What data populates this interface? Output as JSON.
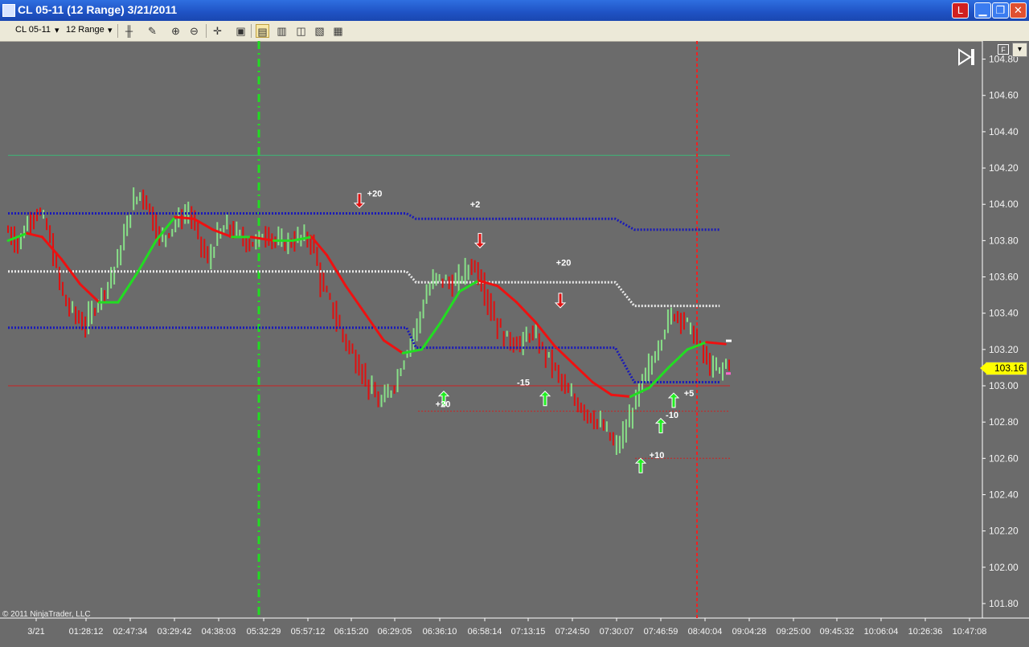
{
  "window": {
    "title": "CL 05-11 (12 Range)  3/21/2011",
    "close_glyph": "✕",
    "min_glyph": "▁",
    "max_glyph": "❐",
    "alert_glyph": "L"
  },
  "toolbar": {
    "instrument": "CL 05-11",
    "interval": "12 Range",
    "dropdown_glyph": "▾"
  },
  "copyright": "© 2011 NinjaTrader, LLC",
  "f_label": "F",
  "current_price_label": "103.16",
  "chart_data": {
    "type": "line",
    "title": "",
    "xlabel": "",
    "ylabel": "",
    "ylim": [
      101.72,
      104.9
    ],
    "yticks": [
      101.8,
      102.0,
      102.2,
      102.4,
      102.6,
      102.8,
      103.0,
      103.2,
      103.4,
      103.6,
      103.8,
      104.0,
      104.2,
      104.4,
      104.6,
      104.8
    ],
    "xtick_labels": [
      "3/21",
      "01:28:12",
      "02:47:34",
      "03:29:42",
      "04:38:03",
      "05:32:29",
      "05:57:12",
      "06:15:20",
      "06:29:05",
      "06:36:10",
      "06:58:14",
      "07:13:15",
      "07:24:50",
      "07:30:07",
      "07:46:59",
      "08:40:04",
      "09:04:28",
      "09:25:00",
      "09:45:32",
      "10:06:04",
      "10:26:36",
      "10:47:08"
    ],
    "bars_count": 225,
    "current_price": 103.16,
    "series": [
      {
        "name": "",
        "style": "close-line",
        "points": [
          [
            0,
            103.85
          ],
          [
            5,
            103.78
          ],
          [
            10,
            103.9
          ],
          [
            15,
            103.97
          ],
          [
            20,
            103.88
          ],
          [
            25,
            103.65
          ],
          [
            30,
            103.45
          ],
          [
            35,
            103.4
          ],
          [
            40,
            103.32
          ],
          [
            45,
            103.43
          ],
          [
            50,
            103.52
          ],
          [
            55,
            103.62
          ],
          [
            60,
            103.78
          ],
          [
            65,
            104.0
          ],
          [
            70,
            104.07
          ],
          [
            75,
            103.95
          ],
          [
            80,
            103.8
          ],
          [
            85,
            103.86
          ],
          [
            90,
            103.92
          ],
          [
            95,
            103.96
          ],
          [
            100,
            103.82
          ],
          [
            105,
            103.68
          ],
          [
            110,
            103.82
          ],
          [
            115,
            103.88
          ],
          [
            120,
            103.84
          ],
          [
            125,
            103.8
          ],
          [
            130,
            103.78
          ],
          [
            135,
            103.85
          ],
          [
            140,
            103.8
          ],
          [
            145,
            103.78
          ],
          [
            150,
            103.8
          ],
          [
            155,
            103.82
          ],
          [
            160,
            103.8
          ],
          [
            165,
            103.55
          ],
          [
            170,
            103.45
          ],
          [
            175,
            103.3
          ],
          [
            180,
            103.2
          ],
          [
            185,
            103.1
          ],
          [
            190,
            103.0
          ],
          [
            195,
            102.9
          ],
          [
            200,
            102.95
          ],
          [
            205,
            103.05
          ],
          [
            210,
            103.2
          ],
          [
            215,
            103.32
          ],
          [
            220,
            103.5
          ],
          [
            225,
            103.6
          ],
          [
            230,
            103.58
          ],
          [
            235,
            103.55
          ],
          [
            240,
            103.62
          ],
          [
            245,
            103.68
          ],
          [
            250,
            103.55
          ],
          [
            255,
            103.4
          ],
          [
            260,
            103.28
          ],
          [
            265,
            103.25
          ],
          [
            270,
            103.22
          ],
          [
            275,
            103.3
          ],
          [
            280,
            103.22
          ],
          [
            285,
            103.15
          ],
          [
            290,
            103.05
          ],
          [
            295,
            102.95
          ],
          [
            300,
            102.9
          ],
          [
            305,
            102.85
          ],
          [
            310,
            102.8
          ],
          [
            315,
            102.75
          ],
          [
            320,
            102.65
          ],
          [
            325,
            102.75
          ],
          [
            330,
            102.9
          ],
          [
            335,
            103.05
          ],
          [
            340,
            103.15
          ],
          [
            345,
            103.3
          ],
          [
            350,
            103.4
          ],
          [
            355,
            103.38
          ],
          [
            360,
            103.3
          ],
          [
            365,
            103.2
          ],
          [
            370,
            103.1
          ],
          [
            375,
            103.08
          ],
          [
            380,
            103.15
          ]
        ]
      },
      {
        "name": "",
        "style": "ma-red-green",
        "points": [
          [
            0,
            103.8
          ],
          [
            10,
            103.84
          ],
          [
            18,
            103.82
          ],
          [
            28,
            103.7
          ],
          [
            38,
            103.56
          ],
          [
            48,
            103.46
          ],
          [
            58,
            103.46
          ],
          [
            68,
            103.62
          ],
          [
            78,
            103.8
          ],
          [
            88,
            103.93
          ],
          [
            98,
            103.92
          ],
          [
            108,
            103.86
          ],
          [
            118,
            103.82
          ],
          [
            128,
            103.82
          ],
          [
            140,
            103.8
          ],
          [
            150,
            103.8
          ],
          [
            160,
            103.82
          ],
          [
            168,
            103.72
          ],
          [
            178,
            103.55
          ],
          [
            188,
            103.4
          ],
          [
            198,
            103.25
          ],
          [
            208,
            103.18
          ],
          [
            218,
            103.2
          ],
          [
            228,
            103.35
          ],
          [
            238,
            103.52
          ],
          [
            248,
            103.58
          ],
          [
            258,
            103.55
          ],
          [
            268,
            103.46
          ],
          [
            278,
            103.35
          ],
          [
            288,
            103.22
          ],
          [
            298,
            103.12
          ],
          [
            308,
            103.02
          ],
          [
            318,
            102.95
          ],
          [
            328,
            102.94
          ],
          [
            338,
            102.99
          ],
          [
            348,
            103.1
          ],
          [
            358,
            103.2
          ],
          [
            368,
            103.24
          ],
          [
            378,
            103.23
          ]
        ]
      },
      {
        "name": "",
        "style": "upper-band",
        "points": [
          [
            0,
            103.95
          ],
          [
            210,
            103.95
          ],
          [
            215,
            103.92
          ],
          [
            320,
            103.92
          ],
          [
            330,
            103.86
          ],
          [
            375,
            103.86
          ]
        ]
      },
      {
        "name": "",
        "style": "mid-band",
        "points": [
          [
            0,
            103.63
          ],
          [
            210,
            103.63
          ],
          [
            215,
            103.57
          ],
          [
            320,
            103.57
          ],
          [
            330,
            103.44
          ],
          [
            375,
            103.44
          ]
        ]
      },
      {
        "name": "",
        "style": "lower-band",
        "points": [
          [
            0,
            103.32
          ],
          [
            210,
            103.32
          ],
          [
            215,
            103.21
          ],
          [
            320,
            103.21
          ],
          [
            330,
            103.02
          ],
          [
            375,
            103.02
          ]
        ]
      }
    ],
    "horizontal_lines": [
      {
        "value": 104.27,
        "color": "#3cb878"
      },
      {
        "value": 103.0,
        "color": "#cc2222"
      },
      {
        "value": 102.86,
        "color": "#cc2222"
      },
      {
        "value": 102.6,
        "color": "#cc2222"
      }
    ],
    "vertical_lines": [
      {
        "x_label": "05:32:29",
        "color": "#22dd22"
      },
      {
        "x_label": "08:40:04",
        "color": "#ee2222"
      }
    ],
    "annotations": [
      {
        "text": "+20",
        "x_ref": "06:15:20",
        "price": 104.06
      },
      {
        "text": "+2",
        "x_ref": "06:58:14",
        "price": 104.0
      },
      {
        "text": "+20",
        "x_ref": "07:13:15",
        "price": 103.68
      },
      {
        "text": "-15",
        "x_ref": "07:13:15",
        "price": 103.02
      },
      {
        "text": "+20",
        "x_ref": "06:36:10",
        "price": 102.9
      },
      {
        "text": "-10",
        "x_ref": "07:46:59",
        "price": 102.84
      },
      {
        "text": "+5",
        "x_ref": "07:46:59",
        "price": 102.96
      },
      {
        "text": "+10",
        "x_ref": "07:46:59",
        "price": 102.62
      }
    ],
    "arrows": [
      {
        "dir": "down",
        "price": 103.98
      },
      {
        "dir": "down",
        "price": 103.76
      },
      {
        "dir": "down",
        "price": 103.43
      },
      {
        "dir": "up",
        "price": 102.97
      },
      {
        "dir": "up",
        "price": 102.97
      },
      {
        "dir": "up",
        "price": 102.96
      },
      {
        "dir": "up",
        "price": 102.82
      },
      {
        "dir": "up",
        "price": 102.6
      }
    ]
  }
}
